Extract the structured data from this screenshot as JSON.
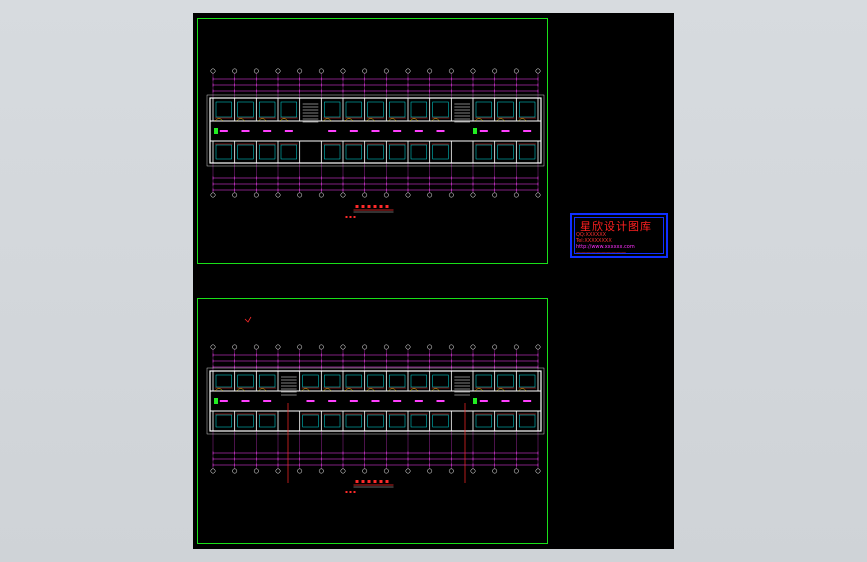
{
  "viewer": {
    "background": "#d4d8dc",
    "sheet_background": "#000000"
  },
  "colors": {
    "frame": "#19e019",
    "axis_line": "#ff2a2a",
    "dim_line": "#ff40ff",
    "wall": "#ffffff",
    "room_line": "#00e5e5",
    "stamp_border": "#1030ff",
    "stamp_text": "#ff2020"
  },
  "drawings": [
    {
      "id": "top",
      "axis_count": 16,
      "room_count": 14,
      "stairs": [
        4,
        11
      ]
    },
    {
      "id": "bottom",
      "axis_count": 16,
      "room_count": 14,
      "stairs": [
        3,
        11
      ]
    }
  ],
  "stamp": {
    "title": "星欣设计图库",
    "line1": "QQ:XXXXXX",
    "line2": "Tel:XXXXXXXX",
    "line3": "http://www.xxxxxx.com",
    "line4": "——————————"
  }
}
